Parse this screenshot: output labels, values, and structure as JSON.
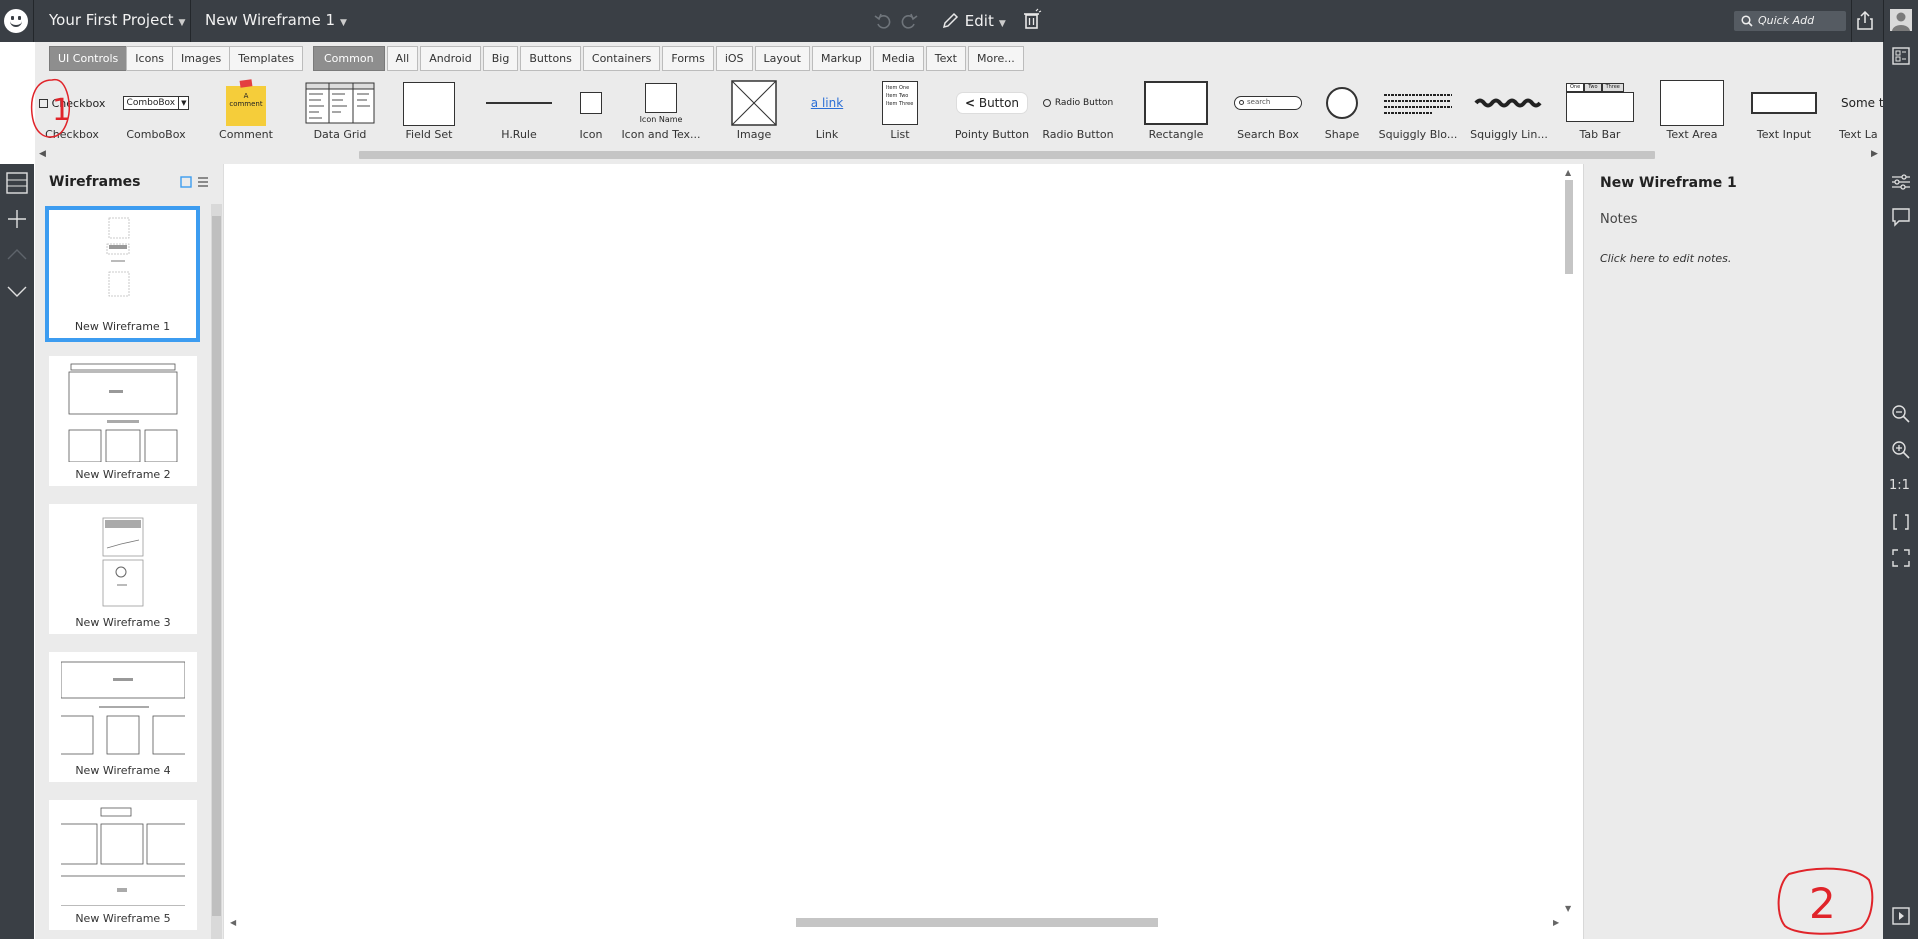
{
  "topbar": {
    "project_title": "Your First Project",
    "wireframe_title": "New Wireframe 1",
    "edit_label": "Edit",
    "quick_add_placeholder": "Quick Add"
  },
  "library": {
    "tabs": [
      "UI Controls",
      "Icons",
      "Images",
      "Templates"
    ],
    "active_tab": "UI Controls",
    "categories": [
      "Common",
      "All",
      "Android",
      "Big",
      "Buttons",
      "Containers",
      "Forms",
      "iOS",
      "Layout",
      "Markup",
      "Media",
      "Text",
      "More..."
    ],
    "active_category": "Common",
    "components": [
      {
        "label": "Checkbox",
        "preview": "Checkbox"
      },
      {
        "label": "ComboBox",
        "preview": "ComboBox"
      },
      {
        "label": "Comment",
        "preview": "A comment"
      },
      {
        "label": "Data Grid"
      },
      {
        "label": "Field Set"
      },
      {
        "label": "H.Rule"
      },
      {
        "label": "Icon"
      },
      {
        "label": "Icon and Tex...",
        "preview": "Icon Name"
      },
      {
        "label": "Image"
      },
      {
        "label": "Link",
        "preview": "a link"
      },
      {
        "label": "List",
        "preview_items": [
          "Item One",
          "Item Two",
          "Item Three"
        ]
      },
      {
        "label": "Pointy Button",
        "preview": "Button"
      },
      {
        "label": "Radio Button",
        "preview": "Radio Button"
      },
      {
        "label": "Rectangle"
      },
      {
        "label": "Search Box",
        "preview": "search"
      },
      {
        "label": "Shape"
      },
      {
        "label": "Squiggly Blo..."
      },
      {
        "label": "Squiggly Lin..."
      },
      {
        "label": "Tab Bar",
        "preview_items": [
          "One",
          "Two",
          "Three"
        ]
      },
      {
        "label": "Text Area"
      },
      {
        "label": "Text Input"
      },
      {
        "label": "Text La",
        "preview": "Some t"
      }
    ]
  },
  "wireframes": {
    "title": "Wireframes",
    "items": [
      {
        "label": "New Wireframe 1",
        "selected": true
      },
      {
        "label": "New Wireframe 2",
        "selected": false
      },
      {
        "label": "New Wireframe 3",
        "selected": false
      },
      {
        "label": "New Wireframe 4",
        "selected": false
      },
      {
        "label": "New Wireframe 5",
        "selected": false
      }
    ]
  },
  "properties": {
    "title": "New Wireframe 1",
    "notes_label": "Notes",
    "notes_hint": "Click here to edit notes."
  },
  "right_toolbar": {
    "zoom_actual_label": "1:1"
  },
  "annotations": [
    "1",
    "2"
  ],
  "colors": {
    "toolbar_bg": "#3a3f45",
    "panel_bg": "#ebebeb",
    "selection": "#3c9cf0",
    "annotation": "#e0242a"
  },
  "icons": [
    "logo-smiley-icon",
    "undo-icon",
    "redo-icon",
    "pencil-icon",
    "trash-icon",
    "search-icon",
    "share-icon",
    "user-avatar-icon",
    "component-inspector-icon",
    "list-panel-icon",
    "plus-icon",
    "chevron-up-icon",
    "chevron-down-icon",
    "properties-sliders-icon",
    "comment-icon",
    "zoom-out-icon",
    "zoom-in-icon",
    "fit-icon",
    "fullscreen-icon",
    "play-icon"
  ]
}
